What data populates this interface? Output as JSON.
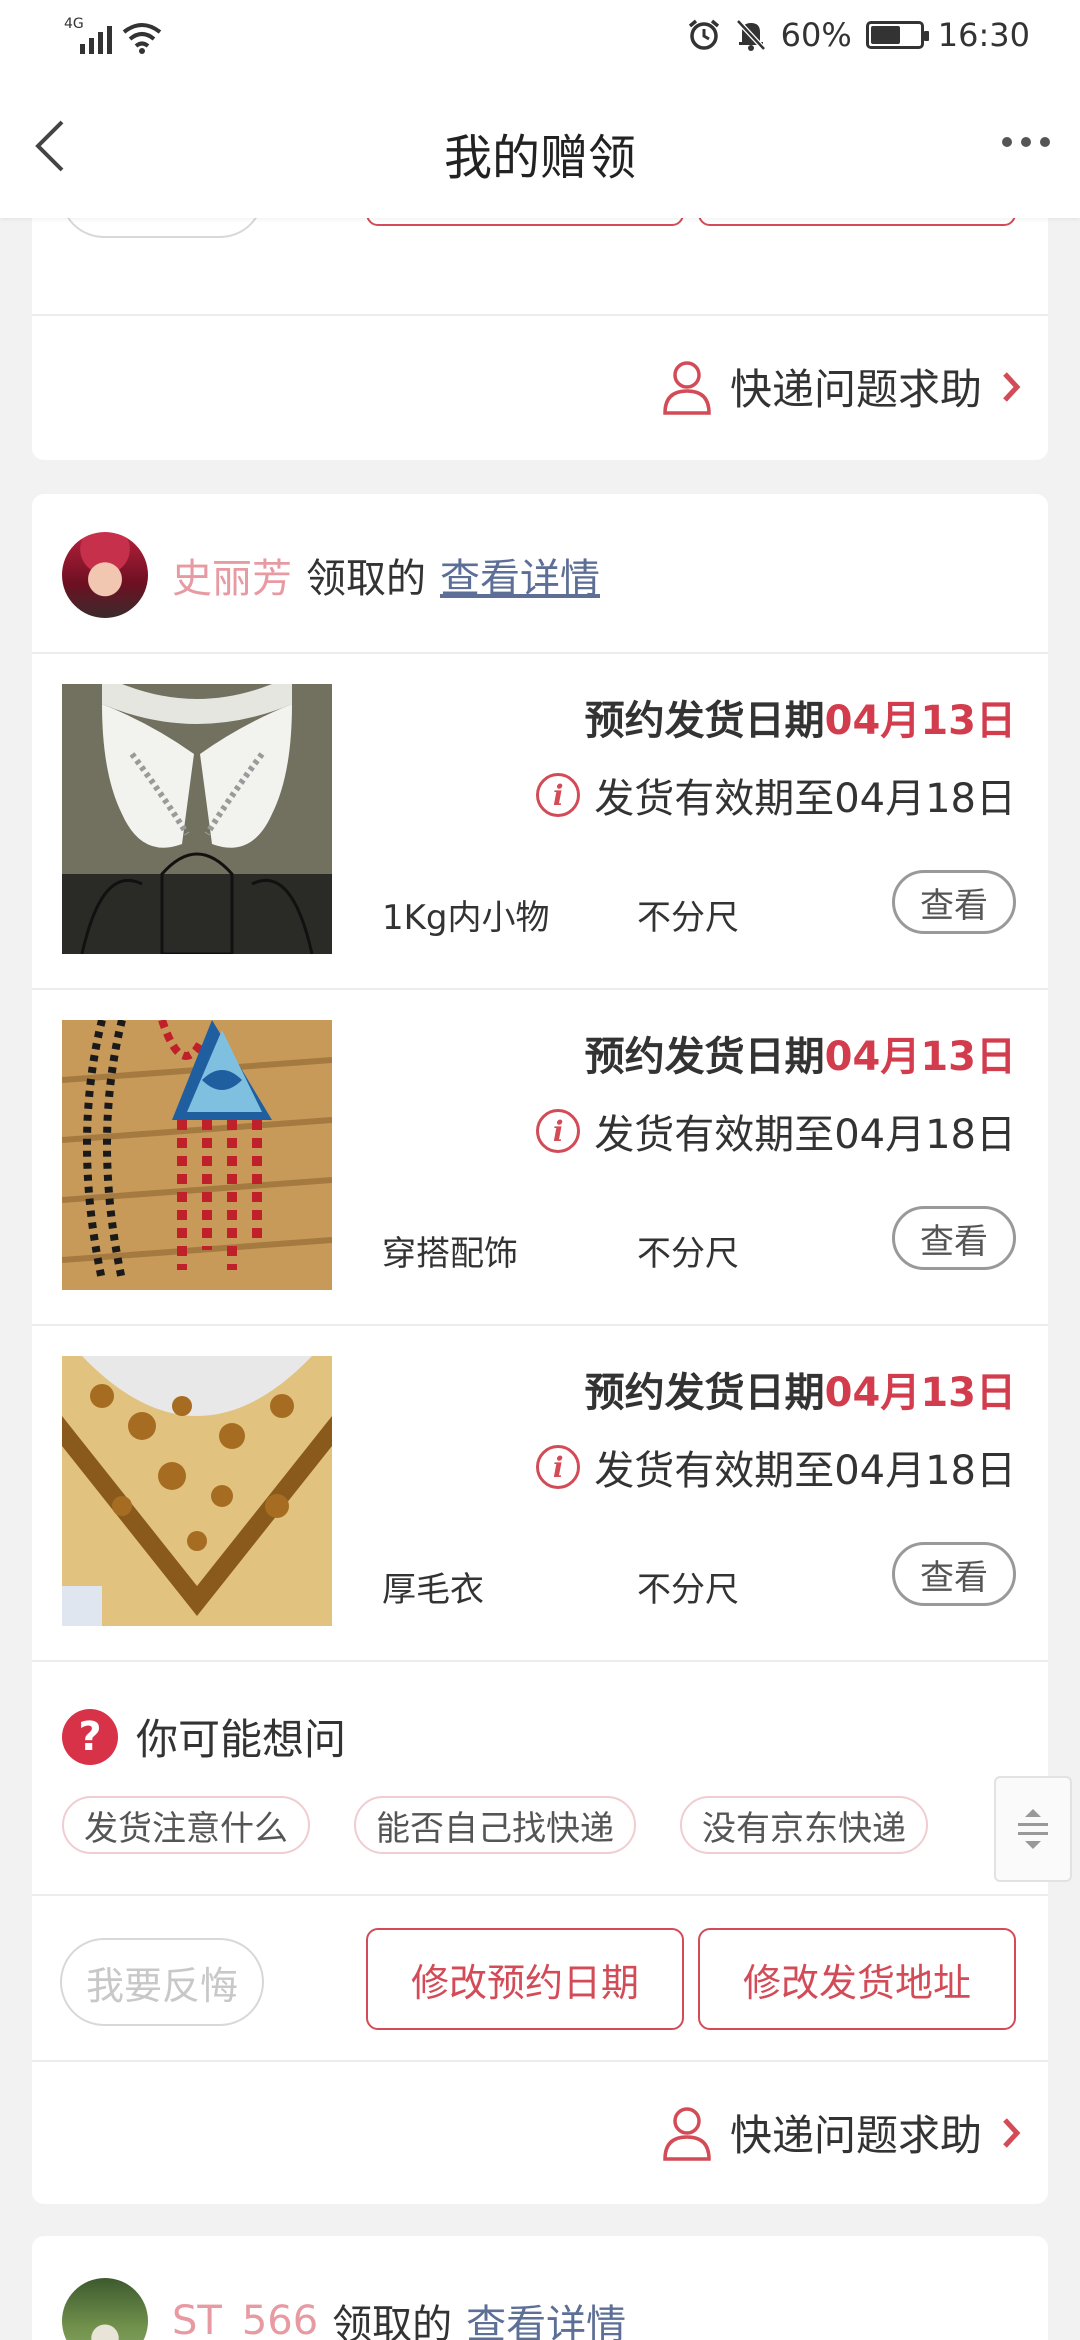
{
  "status_bar": {
    "network": "4G",
    "battery_percent": "60%",
    "battery_level": 0.6,
    "time": "16:30",
    "icons": [
      "signal-icon",
      "wifi-icon",
      "alarm-icon",
      "mute-icon",
      "battery-icon"
    ]
  },
  "nav": {
    "title": "我的赠领",
    "back_icon": "chevron-left-icon",
    "more_icon": "more-icon"
  },
  "actions": {
    "regret": "我要反悔",
    "change_date": "修改预约日期",
    "change_address": "修改发货地址",
    "delivery_help": "快递问题求助"
  },
  "claim_card": {
    "claimer_name": "史丽芳",
    "claimed_suffix": "领取的",
    "detail_link": "查看详情",
    "items": [
      {
        "date_label": "预约发货日期",
        "date_value": "04月13日",
        "valid_text": "发货有效期至04月18日",
        "category": "1Kg内小物",
        "size": "不分尺",
        "view_label": "查看"
      },
      {
        "date_label": "预约发货日期",
        "date_value": "04月13日",
        "valid_text": "发货有效期至04月18日",
        "category": "穿搭配饰",
        "size": "不分尺",
        "view_label": "查看"
      },
      {
        "date_label": "预约发货日期",
        "date_value": "04月13日",
        "valid_text": "发货有效期至04月18日",
        "category": "厚毛衣",
        "size": "不分尺",
        "view_label": "查看"
      }
    ],
    "faq": {
      "title": "你可能想问",
      "chips": [
        "发货注意什么",
        "能否自己找快递",
        "没有京东快递"
      ]
    }
  },
  "next_card": {
    "claimer_name": "ST_566",
    "claimed_suffix": "领取的",
    "detail_link": "查看详情"
  },
  "colors": {
    "accent_red": "#d23c4c",
    "claimer_pink": "#e89aa3",
    "link_blue": "#5d6f96",
    "background": "#f2f2f2"
  }
}
